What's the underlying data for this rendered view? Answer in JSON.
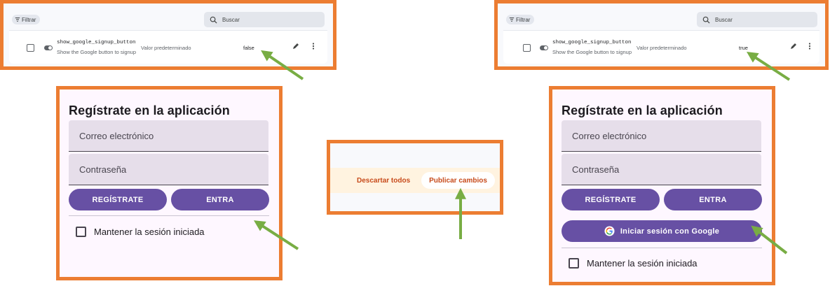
{
  "colors": {
    "frame": "#ec7d32",
    "arrow": "#78ad44",
    "primary": "#6750a4",
    "accent_text": "#c74a1a"
  },
  "remote_config_left": {
    "filter_label": "Filtrar",
    "search_placeholder": "Buscar",
    "param_name": "show_google_signup_button",
    "param_description": "Show the Google button to signup",
    "default_label": "Valor predeterminado",
    "value": "false",
    "icons": [
      "filter-icon",
      "search-icon",
      "toggle-icon",
      "edit-icon",
      "more-vert-icon"
    ]
  },
  "remote_config_right": {
    "filter_label": "Filtrar",
    "search_placeholder": "Buscar",
    "param_name": "show_google_signup_button",
    "param_description": "Show the Google button to signup",
    "default_label": "Valor predeterminado",
    "value": "true"
  },
  "signup_left": {
    "title": "Regístrate en la aplicación",
    "email_placeholder": "Correo electrónico",
    "password_placeholder": "Contraseña",
    "register_label": "REGÍSTRATE",
    "login_label": "ENTRA",
    "keep_session_label": "Mantener la sesión iniciada"
  },
  "signup_right": {
    "title": "Regístrate en la aplicación",
    "email_placeholder": "Correo electrónico",
    "password_placeholder": "Contraseña",
    "register_label": "REGÍSTRATE",
    "login_label": "ENTRA",
    "google_label": "Iniciar sesión con Google",
    "keep_session_label": "Mantener la sesión iniciada"
  },
  "publish": {
    "discard_label": "Descartar todos",
    "publish_label": "Publicar cambios"
  }
}
